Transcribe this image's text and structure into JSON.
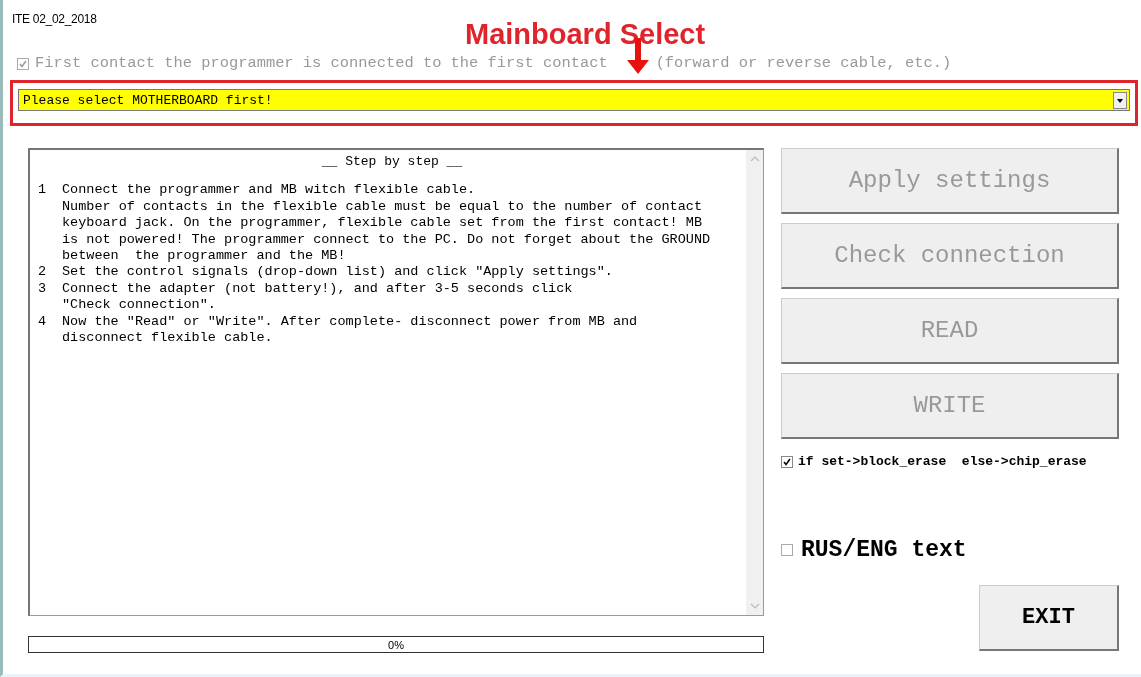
{
  "window": {
    "title": "ITE 02_02_2018"
  },
  "annotation": {
    "label": "Mainboard Select"
  },
  "contact_option": {
    "label": "First contact the programmer is connected to the first contact",
    "label_continued": "(forward or reverse cable, etc.)",
    "checked": true,
    "disabled": true
  },
  "mainboard_dropdown": {
    "value": "Please select MOTHERBOARD first!"
  },
  "instructions": {
    "heading": "__ Step by step __",
    "steps": [
      {
        "number": "1",
        "lines": [
          "Connect the programmer and MB witch flexible cable.",
          "Number of contacts in the flexible cable must be equal to the number of contact",
          "keyboard jack. On the programmer, flexible cable set from the first contact! MB",
          "is not powered! The programmer connect to the PC. Do not forget about the GROUND",
          "between  the programmer and the MB!"
        ]
      },
      {
        "number": "2",
        "lines": [
          "Set the control signals (drop-down list) and click \"Apply settings\"."
        ]
      },
      {
        "number": "3",
        "lines": [
          "Connect the adapter (not battery!), and after 3-5 seconds click",
          "\"Check connection\"."
        ]
      },
      {
        "number": "4",
        "lines": [
          "Now the \"Read\" or \"Write\". After complete- disconnect power from MB and",
          "disconnect flexible cable."
        ]
      }
    ]
  },
  "buttons": [
    {
      "label": "Apply settings",
      "disabled": true
    },
    {
      "label": "Check connection",
      "disabled": true
    },
    {
      "label": "READ",
      "disabled": true
    },
    {
      "label": "WRITE",
      "disabled": true
    }
  ],
  "erase_option": {
    "label": "if set->block_erase  else->chip_erase",
    "checked": true
  },
  "language_option": {
    "label": "RUS/ENG text",
    "checked": false
  },
  "exit_button": {
    "label": "EXIT"
  },
  "progress": {
    "level": 0,
    "reading": "0%"
  }
}
